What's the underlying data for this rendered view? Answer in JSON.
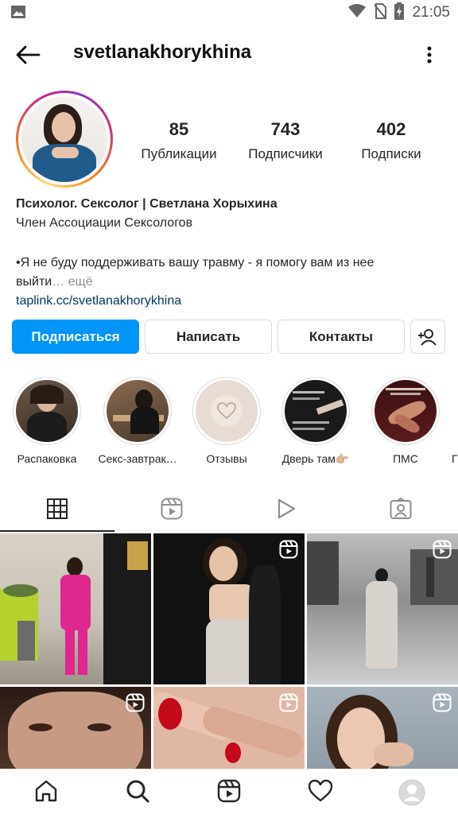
{
  "status_bar": {
    "time": "21:05",
    "icons": [
      "image-icon",
      "wifi-icon",
      "no-sim-icon",
      "battery-charging-icon"
    ]
  },
  "header": {
    "username": "svetlanakhorykhina",
    "back_icon": "arrow-left-icon",
    "more_icon": "more-vertical-icon"
  },
  "profile": {
    "stats": [
      {
        "value": "85",
        "label": "Публикации"
      },
      {
        "value": "743",
        "label": "Подписчики"
      },
      {
        "value": "402",
        "label": "Подписки"
      }
    ],
    "bio": {
      "name": "Психолог. Сексолог | Светлана Хорыхина",
      "line1": "Член Ассоциации Сексологов",
      "line2": "•Я не буду поддерживать вашу травму - я помогу вам из нее",
      "line3": "выйти",
      "more": "… ещё",
      "link": "taplink.cc/svetlanakhorykhina"
    }
  },
  "actions": {
    "follow": "Подписаться",
    "message": "Написать",
    "contacts": "Контакты",
    "add_user_icon": "person-add-icon"
  },
  "highlights": [
    {
      "label": "Распаковка"
    },
    {
      "label": "Секс-завтрак…"
    },
    {
      "label": "Отзывы"
    },
    {
      "label": "Дверь там👉🏼"
    },
    {
      "label": "ПМС"
    },
    {
      "label": "Г"
    }
  ],
  "tabs": [
    {
      "name": "grid",
      "icon": "grid-icon",
      "active": true
    },
    {
      "name": "reels",
      "icon": "reels-icon",
      "active": false
    },
    {
      "name": "igtv",
      "icon": "play-icon",
      "active": false
    },
    {
      "name": "tagged",
      "icon": "tagged-person-icon",
      "active": false
    }
  ],
  "posts": [
    {
      "type": "photo"
    },
    {
      "type": "reel"
    },
    {
      "type": "reel"
    },
    {
      "type": "reel"
    },
    {
      "type": "reel"
    },
    {
      "type": "reel"
    }
  ],
  "bottom_nav": [
    {
      "name": "home",
      "icon": "home-icon",
      "dot": true
    },
    {
      "name": "search",
      "icon": "search-icon",
      "dot": false
    },
    {
      "name": "reels",
      "icon": "reels-icon",
      "dot": false
    },
    {
      "name": "activity",
      "icon": "heart-icon",
      "dot": true
    },
    {
      "name": "profile",
      "icon": "profile-avatar-icon",
      "dot": true
    }
  ],
  "colors": {
    "primary": "#0095f6",
    "text": "#262626",
    "secondary_text": "#8e8e8e",
    "link": "#00376b",
    "notification_dot": "#ed4956"
  }
}
